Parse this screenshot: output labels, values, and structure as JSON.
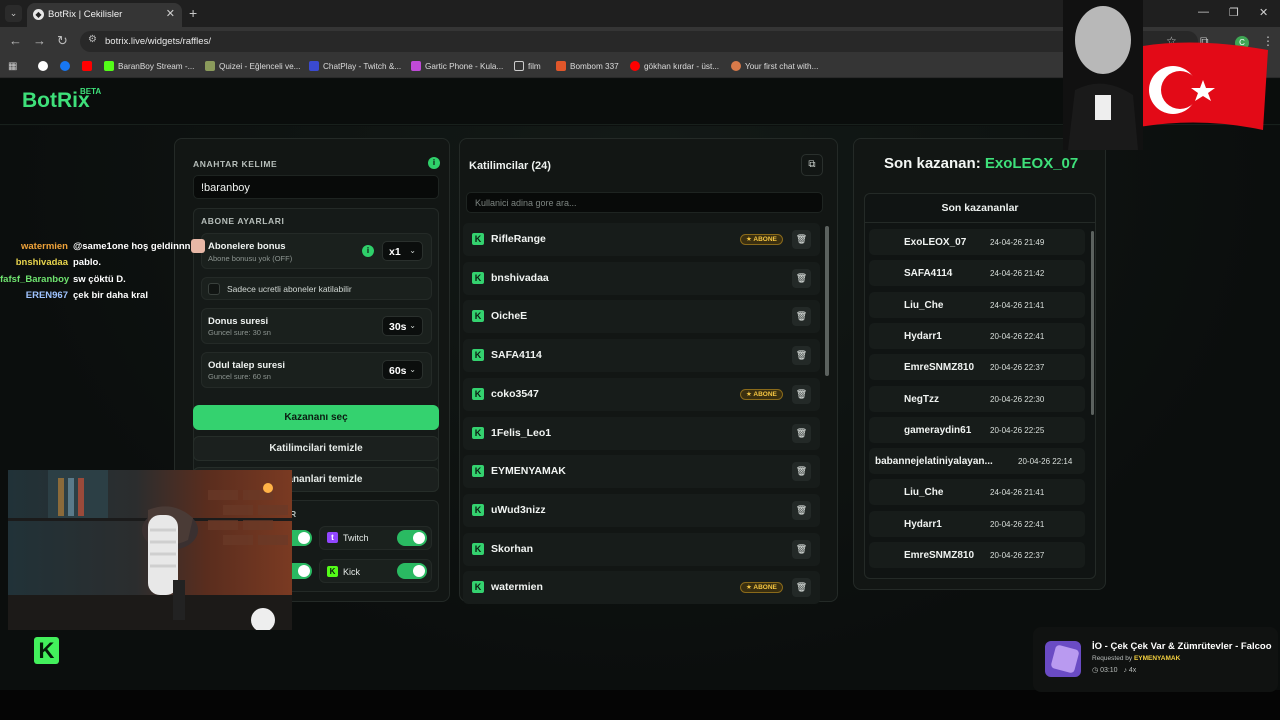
{
  "browser": {
    "tab_title": "BotRix | Cekilisler",
    "url": "botrix.live/widgets/raffles/",
    "bookmarks": [
      "BaranBoy Stream -...",
      "Quizei - Eğlenceli ve...",
      "ChatPlay - Twitch &...",
      "Gartic Phone - Kula...",
      "film",
      "Bombom 337",
      "gökhan kırdar - üst...",
      "Your first chat with..."
    ],
    "profile_initial": "C"
  },
  "app": {
    "logo": "BotRix",
    "beta": "BETA"
  },
  "settings": {
    "keyword_label": "ANAHTAR KELIME",
    "keyword_value": "!baranboy",
    "sub_section_label": "ABONE AYARLARI",
    "sub_bonus_title": "Abonelere bonus",
    "sub_bonus_sub": "Abone bonusu yok (OFF)",
    "sub_bonus_value": "x1",
    "only_subs_label": "Sadece ucretli aboneler katilabilir",
    "duration_title": "Donus suresi",
    "duration_sub": "Guncel sure: 30 sn",
    "duration_value": "30s",
    "claim_title": "Odul talep suresi",
    "claim_sub": "Guncel sure: 60 sn",
    "claim_value": "60s",
    "pick_winner": "Kazananı seç",
    "clear_participants": "Katilimcilari temizle",
    "clear_winners": "Kazananlari temizle",
    "platform_label": "R",
    "platform_twitch": "Twitch",
    "platform_kick": "Kick"
  },
  "participants": {
    "title": "Katilimcilar (24)",
    "search_placeholder": "Kullanici adina gore ara...",
    "badge": "ABONE",
    "rows": [
      {
        "name": "RifleRange",
        "sub": true
      },
      {
        "name": "bnshivadaa",
        "sub": false
      },
      {
        "name": "OicheE",
        "sub": false
      },
      {
        "name": "SAFA4114",
        "sub": false
      },
      {
        "name": "coko3547",
        "sub": true
      },
      {
        "name": "1Felis_Leo1",
        "sub": false
      },
      {
        "name": "EYMENYAMAK",
        "sub": false
      },
      {
        "name": "uWud3nizz",
        "sub": false
      },
      {
        "name": "Skorhan",
        "sub": false
      },
      {
        "name": "watermien",
        "sub": true
      }
    ]
  },
  "winners": {
    "last_winner_prefix": "Son kazanan:",
    "last_winner_name": "ExoLEOX_07",
    "list_title": "Son kazananlar",
    "rows": [
      {
        "name": "ExoLEOX_07",
        "date": "24-04-26 21:49"
      },
      {
        "name": "SAFA4114",
        "date": "24-04-26 21:42"
      },
      {
        "name": "Liu_Che",
        "date": "24-04-26 21:41"
      },
      {
        "name": "Hydarr1",
        "date": "20-04-26 22:41"
      },
      {
        "name": "EmreSNMZ810",
        "date": "20-04-26 22:37"
      },
      {
        "name": "NegTzz",
        "date": "20-04-26 22:30"
      },
      {
        "name": "gameraydin61",
        "date": "20-04-26 22:25"
      },
      {
        "name": "babannejelatiniyalayan...",
        "date": "20-04-26 22:14"
      },
      {
        "name": "Liu_Che",
        "date": "24-04-26 21:41"
      },
      {
        "name": "Hydarr1",
        "date": "20-04-26 22:41"
      },
      {
        "name": "EmreSNMZ810",
        "date": "20-04-26 22:37"
      }
    ]
  },
  "chat": [
    {
      "user": "watermien",
      "msg": "@same1one hoş geldinnn",
      "color": "#f0a33a"
    },
    {
      "user": "bnshivadaa",
      "msg": "pablo.",
      "color": "#e8d44d"
    },
    {
      "user": "fafsf_Baranboy",
      "msg": "sw çöktü D.",
      "color": "#6fe36f"
    },
    {
      "user": "EREN967",
      "msg": "çek bir daha kral",
      "color": "#9fc3ff"
    }
  ],
  "now_playing": {
    "title": "İO - Çek Çek Var & Zümrütevler - Falcoo",
    "requested_by_label": "Requested by",
    "requested_by": "EYMENYAMAK",
    "time": "03:10",
    "count": "4x"
  },
  "colors": {
    "accent": "#34d26f",
    "sub_badge": "#f4c542"
  }
}
